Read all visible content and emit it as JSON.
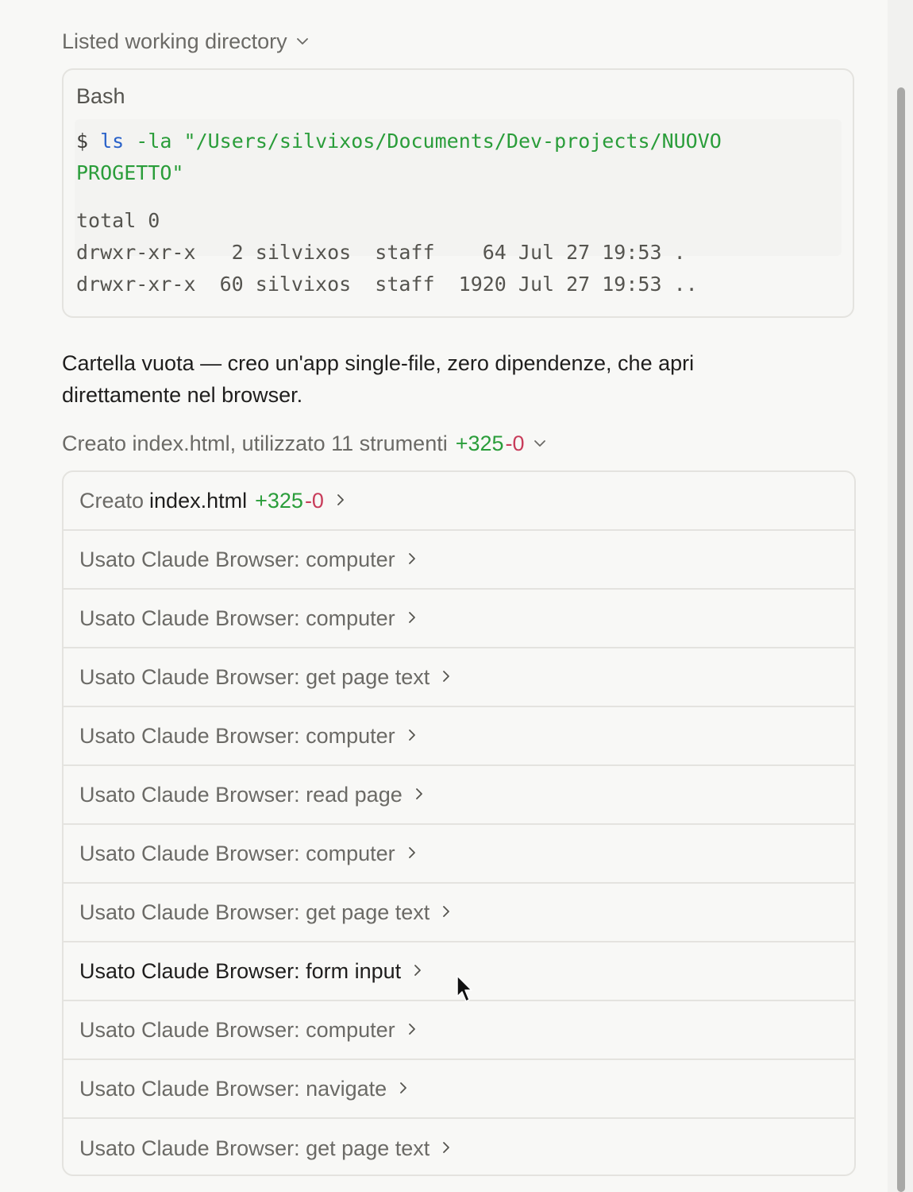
{
  "step1": {
    "label": "Listed working directory",
    "chevron": "chevron-down-icon"
  },
  "bash": {
    "title": "Bash",
    "prompt": "$",
    "command": "ls",
    "flag": "-la",
    "path": "\"/Users/silvixos/Documents/Dev-projects/NUOVO PROGETTO\"",
    "output": [
      "total 0",
      "drwxr-xr-x   2 silvixos  staff    64 Jul 27 19:53 .",
      "drwxr-xr-x  60 silvixos  staff  1920 Jul 27 19:53 .."
    ]
  },
  "assistant_text": "Cartella vuota — creo un'app single-file, zero dipendenze, che apri direttamente nel browser.",
  "step2": {
    "label": "Creato index.html, utilizzato 11 strumenti",
    "added": "+325",
    "removed": "-0",
    "chevron": "chevron-down-icon"
  },
  "created_file": {
    "prefix": "Creato",
    "name": "index.html",
    "added": "+325",
    "removed": "-0"
  },
  "tools": [
    "Usato Claude Browser: computer",
    "Usato Claude Browser: computer",
    "Usato Claude Browser: get page text",
    "Usato Claude Browser: computer",
    "Usato Claude Browser: read page",
    "Usato Claude Browser: computer",
    "Usato Claude Browser: get page text",
    "Usato Claude Browser: form input",
    "Usato Claude Browser: computer",
    "Usato Claude Browser: navigate",
    "Usato Claude Browser: get page text"
  ],
  "hovered_tool_index": 7,
  "colors": {
    "added": "#2a9d3a",
    "removed": "#c83c5a",
    "command": "#2a62c9",
    "path": "#2a9d3a"
  }
}
